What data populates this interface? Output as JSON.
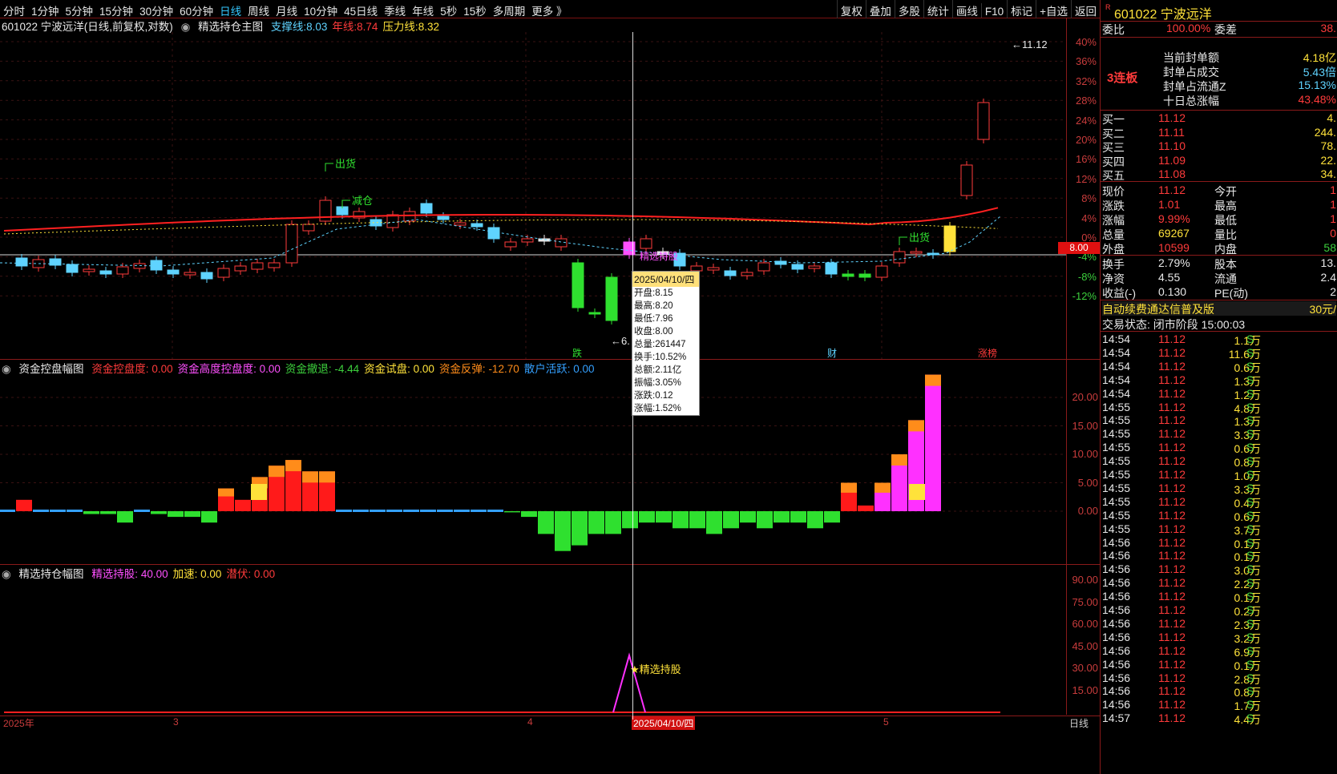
{
  "toolbar": {
    "periods": [
      "分时",
      "1分钟",
      "5分钟",
      "15分钟",
      "30分钟",
      "60分钟",
      "日线",
      "周线",
      "月线",
      "10分钟",
      "45日线",
      "季线",
      "年线",
      "5秒",
      "15秒",
      "多周期",
      "更多 》"
    ],
    "active_period": "日线",
    "right_buttons": [
      "复权",
      "叠加",
      "多股",
      "统计",
      "画线",
      "F10",
      "标记",
      "返回"
    ],
    "self_select": "+自选"
  },
  "main_chart": {
    "title": "601022 宁波远洋(日线,前复权,对数)",
    "indicator": "精选持仓主图",
    "lines": [
      {
        "name": "支撑线",
        "value": "8.03",
        "color": "#5fd3ff"
      },
      {
        "name": "年线",
        "value": "8.74",
        "color": "#ff3b3b"
      },
      {
        "name": "压力线",
        "value": "8.32",
        "color": "#ffe23a"
      }
    ],
    "price_axis": [
      "40%",
      "36%",
      "32%",
      "28%",
      "24%",
      "20%",
      "16%",
      "12%",
      "8%",
      "4%",
      "0%",
      "-4%",
      "-8%",
      "-12%"
    ],
    "current_price_tag": "8.00",
    "high_label": "11.12",
    "low_label": "6.",
    "annotations": {
      "sell1": "出货",
      "reduce": "减仓",
      "sell2": "出货",
      "select": "精选持股"
    },
    "markers": [
      "跌",
      "财",
      "涨榜"
    ]
  },
  "tooltip": {
    "date": "2025/04/10/四",
    "rows": [
      "开盘:8.15",
      "最高:8.20",
      "最低:7.96",
      "收盘:8.00",
      "总量:261447",
      "换手:10.52%",
      "总额:2.11亿",
      "振幅:3.05%",
      "涨跌:0.12",
      "涨幅:1.52%"
    ]
  },
  "sub1": {
    "name": "资金控盘幅图",
    "items": [
      {
        "name": "资金控盘度",
        "value": "0.00",
        "color": "#ff3b3b"
      },
      {
        "name": "资金高度控盘度",
        "value": "0.00",
        "color": "#ff50ff"
      },
      {
        "name": "资金撤退",
        "value": "-4.44",
        "color": "#3ccf3c"
      },
      {
        "name": "资金试盘",
        "value": "0.00",
        "color": "#ffe23a"
      },
      {
        "name": "资金反弹",
        "value": "-12.70",
        "color": "#ff8c1a"
      },
      {
        "name": "散户活跃",
        "value": "0.00",
        "color": "#34a0ff"
      }
    ],
    "axis": [
      "20.00",
      "15.00",
      "10.00",
      "5.00",
      "0.00"
    ]
  },
  "sub2": {
    "name": "精选持仓幅图",
    "items": [
      {
        "name": "精选持股",
        "value": "40.00",
        "color": "#ff50ff"
      },
      {
        "name": "加速",
        "value": "0.00",
        "color": "#ffe23a"
      },
      {
        "name": "潜伏",
        "value": "0.00",
        "color": "#ff3b3b"
      }
    ],
    "axis": [
      "90.00",
      "75.00",
      "60.00",
      "45.00",
      "30.00",
      "15.00"
    ],
    "select_label": "精选持股"
  },
  "x_axis": {
    "labels": [
      "2025年",
      "3",
      "4",
      "5"
    ],
    "cursor_date": "2025/04/10/四",
    "period": "日线"
  },
  "chart_data": {
    "type": "candlestick",
    "candles_visible": 58,
    "sub1_values": [
      0,
      2,
      0,
      0,
      0,
      -0.5,
      -0.5,
      -2,
      0,
      -0.5,
      -1,
      -1,
      -2,
      4,
      2,
      6,
      8,
      9,
      7,
      7,
      0,
      0,
      0,
      0,
      0,
      0,
      0,
      0,
      0,
      0,
      -0.2,
      -1,
      -4,
      -7,
      -6,
      -4,
      -4,
      -3,
      -2,
      -2,
      -3,
      -3,
      -4,
      -3,
      -2,
      -3,
      -2,
      -2,
      -3,
      -2,
      5,
      1,
      5,
      10,
      16,
      24
    ],
    "sub2_peak": 40
  },
  "right_panel": {
    "code": "601022",
    "name": "宁波远洋",
    "wei_bi": "100.00%",
    "wei_cha": "38.",
    "board": "3连板",
    "seal_rows": [
      {
        "label": "当前封单额",
        "value": "4.18亿",
        "color": "#ffe23a"
      },
      {
        "label": "封单占成交",
        "value": "5.43倍",
        "color": "#5fd3ff"
      },
      {
        "label": "封单占流通Z",
        "value": "15.13%",
        "color": "#5fd3ff"
      },
      {
        "label": "十日总涨幅",
        "value": "43.48%",
        "color": "#ff3b3b"
      }
    ],
    "bids": [
      {
        "label": "买一",
        "price": "11.12",
        "vol": "4."
      },
      {
        "label": "买二",
        "price": "11.11",
        "vol": "244."
      },
      {
        "label": "买三",
        "price": "11.10",
        "vol": "78."
      },
      {
        "label": "买四",
        "price": "11.09",
        "vol": "22."
      },
      {
        "label": "买五",
        "price": "11.08",
        "vol": "34."
      }
    ],
    "quote": [
      {
        "l1": "现价",
        "v1": "11.12",
        "l2": "今开",
        "v2": "1"
      },
      {
        "l1": "涨跌",
        "v1": "1.01",
        "l2": "最高",
        "v2": "1"
      },
      {
        "l1": "涨幅",
        "v1": "9.99%",
        "l2": "最低",
        "v2": "1"
      },
      {
        "l1": "总量",
        "v1": "69267",
        "l2": "量比",
        "v2": "0"
      },
      {
        "l1": "外盘",
        "v1": "10599",
        "l2": "内盘",
        "v2": "58"
      }
    ],
    "stats": [
      {
        "l1": "换手",
        "v1": "2.79%",
        "l2": "股本",
        "v2": "13."
      },
      {
        "l1": "净资",
        "v1": "4.55",
        "l2": "流通",
        "v2": "2.4"
      },
      {
        "l1": "收益(-)",
        "v1": "0.130",
        "l2": "PE(动)",
        "v2": "2"
      }
    ],
    "notice": "自动续费通达信普及版",
    "notice_price": "30元/",
    "status_label": "交易状态:",
    "status_value": "闭市阶段 15:00:03",
    "trades": [
      [
        "14:54",
        "11.12",
        "1.1万",
        "S"
      ],
      [
        "14:54",
        "11.12",
        "11.6万",
        "S"
      ],
      [
        "14:54",
        "11.12",
        "0.6万",
        "S"
      ],
      [
        "14:54",
        "11.12",
        "1.3万",
        "S"
      ],
      [
        "14:54",
        "11.12",
        "1.2万",
        "S"
      ],
      [
        "14:55",
        "11.12",
        "4.8万",
        "S"
      ],
      [
        "14:55",
        "11.12",
        "1.3万",
        "S"
      ],
      [
        "14:55",
        "11.12",
        "3.3万",
        "S"
      ],
      [
        "14:55",
        "11.12",
        "0.6万",
        "S"
      ],
      [
        "14:55",
        "11.12",
        "0.8万",
        "S"
      ],
      [
        "14:55",
        "11.12",
        "1.0万",
        "S"
      ],
      [
        "14:55",
        "11.12",
        "3.3万",
        "S"
      ],
      [
        "14:55",
        "11.12",
        "0.4万",
        "S"
      ],
      [
        "14:55",
        "11.12",
        "0.6万",
        "S"
      ],
      [
        "14:55",
        "11.12",
        "3.7万",
        "S"
      ],
      [
        "14:56",
        "11.12",
        "0.1万",
        "S"
      ],
      [
        "14:56",
        "11.12",
        "0.1万",
        "S"
      ],
      [
        "14:56",
        "11.12",
        "3.0万",
        "S"
      ],
      [
        "14:56",
        "11.12",
        "2.2万",
        "S"
      ],
      [
        "14:56",
        "11.12",
        "0.1万",
        "S"
      ],
      [
        "14:56",
        "11.12",
        "0.2万",
        "S"
      ],
      [
        "14:56",
        "11.12",
        "2.3万",
        "S"
      ],
      [
        "14:56",
        "11.12",
        "3.2万",
        "S"
      ],
      [
        "14:56",
        "11.12",
        "6.9万",
        "S"
      ],
      [
        "14:56",
        "11.12",
        "0.1万",
        "S"
      ],
      [
        "14:56",
        "11.12",
        "2.8万",
        "S"
      ],
      [
        "14:56",
        "11.12",
        "0.8万",
        "S"
      ],
      [
        "14:56",
        "11.12",
        "1.7万",
        "S"
      ],
      [
        "14:57",
        "11.12",
        "4.4万",
        "S"
      ]
    ]
  }
}
